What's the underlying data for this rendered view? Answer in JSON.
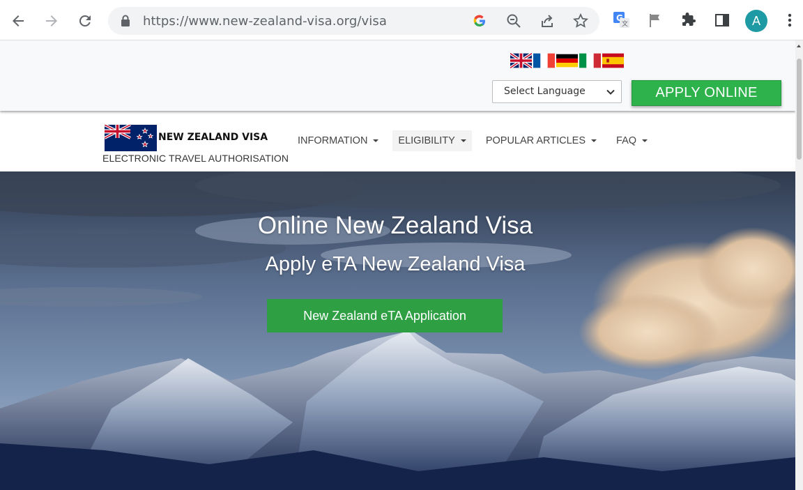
{
  "browser": {
    "url_host": "https://www.new-zealand-visa.org",
    "url_path": "/visa",
    "profile_initial": "A"
  },
  "topbar": {
    "flags": [
      "uk-flag-icon",
      "france-flag-icon",
      "germany-flag-icon",
      "italy-flag-icon",
      "spain-flag-icon"
    ],
    "language_select": "Select Language",
    "apply_button": "APPLY ONLINE"
  },
  "navbar": {
    "brand_title": "NEW ZEALAND VISA",
    "brand_subtitle": "ELECTRONIC TRAVEL AUTHORISATION",
    "menu": [
      {
        "label": "INFORMATION"
      },
      {
        "label": "ELIGIBILITY"
      },
      {
        "label": "POPULAR ARTICLES"
      },
      {
        "label": "FAQ"
      }
    ]
  },
  "hero": {
    "title": "Online New Zealand Visa",
    "subtitle": "Apply eTA New Zealand Visa",
    "cta": "New Zealand eTA Application"
  },
  "colors": {
    "apply_green": "#2eb24b",
    "cta_green": "#2ea043",
    "avatar_teal": "#1d9aa3"
  }
}
